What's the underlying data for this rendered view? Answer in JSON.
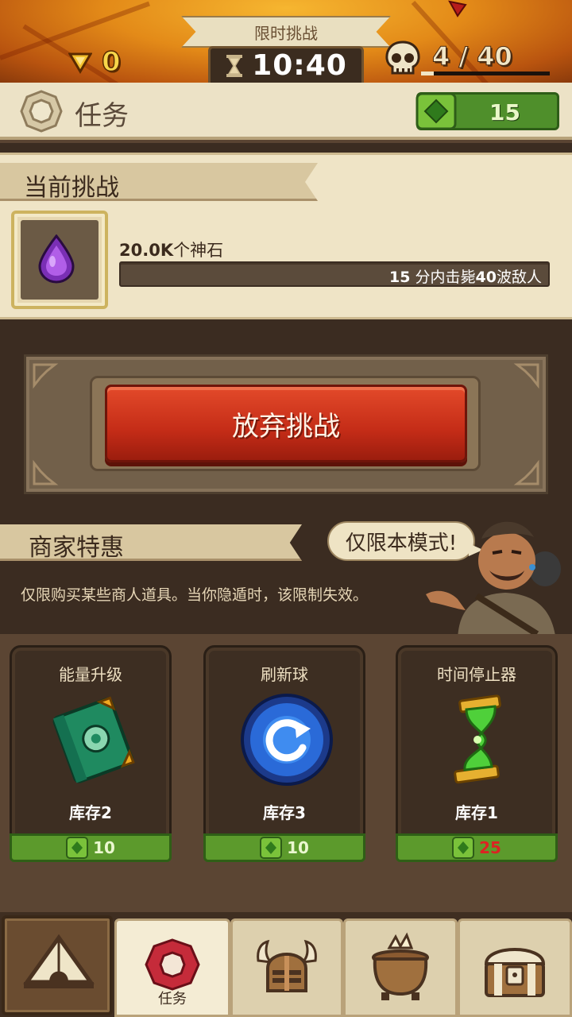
{
  "hud": {
    "gems": "0",
    "timer_label": "限时挑战",
    "timer": "10:40",
    "wave_count": "4 / 40",
    "wave_progress": 0.1
  },
  "header": {
    "title": "任务",
    "green_count": "15"
  },
  "challenge": {
    "section_title": "当前挑战",
    "reward_amount": "20.0K",
    "reward_unit": "个神石",
    "goal_minutes": "15",
    "goal_mid": " 分内击毙",
    "goal_waves": "40",
    "goal_end": "波敌人",
    "abandon_label": "放弃挑战"
  },
  "merchant": {
    "section_title": "商家特惠",
    "bubble": "仅限本模式!",
    "notice": "仅限购买某些商人道具。当你隐遁时，该限制失效。",
    "items": [
      {
        "name": "能量升级",
        "stock": "库存2",
        "price": "10",
        "affordable": true,
        "icon": "spellbook-icon"
      },
      {
        "name": "刷新球",
        "stock": "库存3",
        "price": "10",
        "affordable": true,
        "icon": "refresh-orb-icon"
      },
      {
        "name": "时间停止器",
        "stock": "库存1",
        "price": "25",
        "affordable": false,
        "icon": "hourglass-green-icon"
      }
    ]
  },
  "nav": {
    "active_label": "任务"
  },
  "colors": {
    "accent_green": "#5c9a2c",
    "abandon_red": "#c42c17",
    "price_red": "#d22222"
  }
}
